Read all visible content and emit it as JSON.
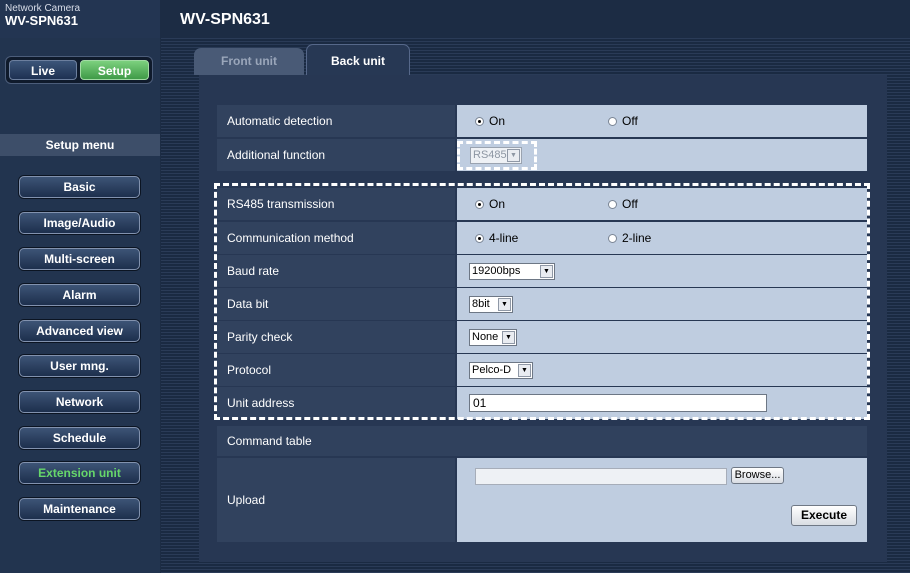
{
  "header": {
    "brand_sub": "Network Camera",
    "brand_model": "WV-SPN631",
    "page_title": "WV-SPN631"
  },
  "mode": {
    "live_label": "Live",
    "setup_label": "Setup"
  },
  "sidebar": {
    "menu_title": "Setup menu",
    "active_color": "#66d66a",
    "items": [
      {
        "label": "Basic"
      },
      {
        "label": "Image/Audio"
      },
      {
        "label": "Multi-screen"
      },
      {
        "label": "Alarm"
      },
      {
        "label": "Advanced view"
      },
      {
        "label": "User mng."
      },
      {
        "label": "Network"
      },
      {
        "label": "Schedule"
      },
      {
        "label": "Extension unit",
        "active": true
      },
      {
        "label": "Maintenance"
      }
    ]
  },
  "tabs": [
    {
      "label": "Front unit",
      "selected": false
    },
    {
      "label": "Back unit",
      "selected": true
    }
  ],
  "settings": {
    "automatic_detection": {
      "label": "Automatic detection",
      "options": [
        "On",
        "Off"
      ],
      "selected": "On"
    },
    "additional_function": {
      "label": "Additional function",
      "value": "RS485",
      "disabled": true
    },
    "rs485_transmission": {
      "label": "RS485 transmission",
      "options": [
        "On",
        "Off"
      ],
      "selected": "On"
    },
    "communication_method": {
      "label": "Communication method",
      "options": [
        "4-line",
        "2-line"
      ],
      "selected": "4-line"
    },
    "baud_rate": {
      "label": "Baud rate",
      "value": "19200bps"
    },
    "data_bit": {
      "label": "Data bit",
      "value": "8bit"
    },
    "parity_check": {
      "label": "Parity check",
      "value": "None"
    },
    "protocol": {
      "label": "Protocol",
      "value": "Pelco-D"
    },
    "unit_address": {
      "label": "Unit address",
      "value": "01"
    }
  },
  "command_table": {
    "header": "Command table",
    "upload_label": "Upload",
    "file_path": "",
    "browse_label": "Browse...",
    "execute_label": "Execute"
  },
  "icons": {
    "radio_on": "radio-selected-icon",
    "radio_off": "radio-unselected-icon",
    "dropdown": "chevron-down-icon"
  }
}
